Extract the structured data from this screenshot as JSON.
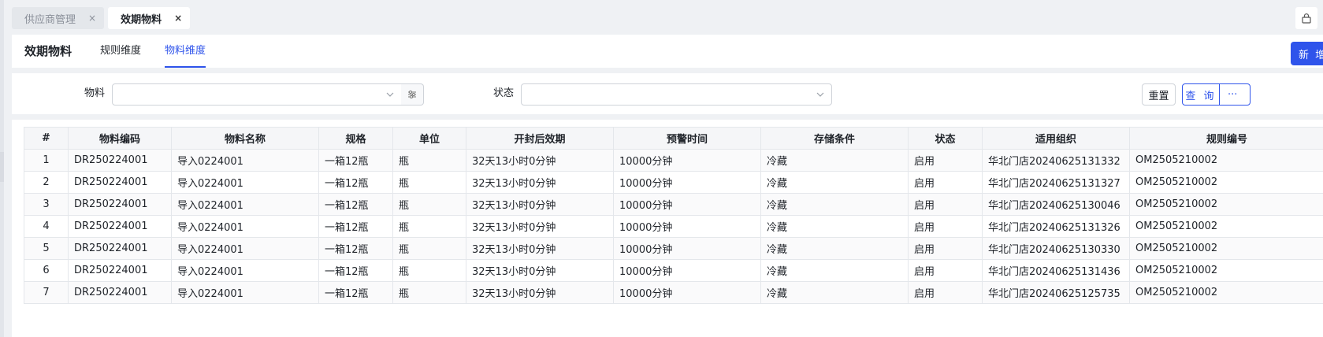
{
  "tabs": [
    {
      "label": "供应商管理",
      "active": false
    },
    {
      "label": "效期物料",
      "active": true
    }
  ],
  "tab_close_glyph": "×",
  "header": {
    "title": "效期物料",
    "subtabs": [
      {
        "label": "规则维度",
        "active": false
      },
      {
        "label": "物料维度",
        "active": true
      }
    ],
    "add_label": "新 增"
  },
  "filters": {
    "material_label": "物料",
    "status_label": "状态",
    "material_value": "",
    "status_value": "",
    "reset_label": "重置",
    "query_label": "查 询",
    "more_label": "···"
  },
  "table": {
    "columns": [
      "#",
      "物料编码",
      "物料名称",
      "规格",
      "单位",
      "开封后效期",
      "预警时间",
      "存储条件",
      "状态",
      "适用组织",
      "规则编号"
    ],
    "rows": [
      [
        "1",
        "DR250224001",
        "导入0224001",
        "一箱12瓶",
        "瓶",
        "32天13小时0分钟",
        "10000分钟",
        "冷藏",
        "启用",
        "华北门店20240625131332",
        "OM2505210002"
      ],
      [
        "2",
        "DR250224001",
        "导入0224001",
        "一箱12瓶",
        "瓶",
        "32天13小时0分钟",
        "10000分钟",
        "冷藏",
        "启用",
        "华北门店20240625131327",
        "OM2505210002"
      ],
      [
        "3",
        "DR250224001",
        "导入0224001",
        "一箱12瓶",
        "瓶",
        "32天13小时0分钟",
        "10000分钟",
        "冷藏",
        "启用",
        "华北门店20240625130046",
        "OM2505210002"
      ],
      [
        "4",
        "DR250224001",
        "导入0224001",
        "一箱12瓶",
        "瓶",
        "32天13小时0分钟",
        "10000分钟",
        "冷藏",
        "启用",
        "华北门店20240625131326",
        "OM2505210002"
      ],
      [
        "5",
        "DR250224001",
        "导入0224001",
        "一箱12瓶",
        "瓶",
        "32天13小时0分钟",
        "10000分钟",
        "冷藏",
        "启用",
        "华北门店20240625130330",
        "OM2505210002"
      ],
      [
        "6",
        "DR250224001",
        "导入0224001",
        "一箱12瓶",
        "瓶",
        "32天13小时0分钟",
        "10000分钟",
        "冷藏",
        "启用",
        "华北门店20240625131436",
        "OM2505210002"
      ],
      [
        "7",
        "DR250224001",
        "导入0224001",
        "一箱12瓶",
        "瓶",
        "32天13小时0分钟",
        "10000分钟",
        "冷藏",
        "启用",
        "华北门店20240625125735",
        "OM2505210002"
      ]
    ]
  },
  "colors": {
    "accent": "#2f54eb",
    "page_bg": "#eff1f4"
  }
}
